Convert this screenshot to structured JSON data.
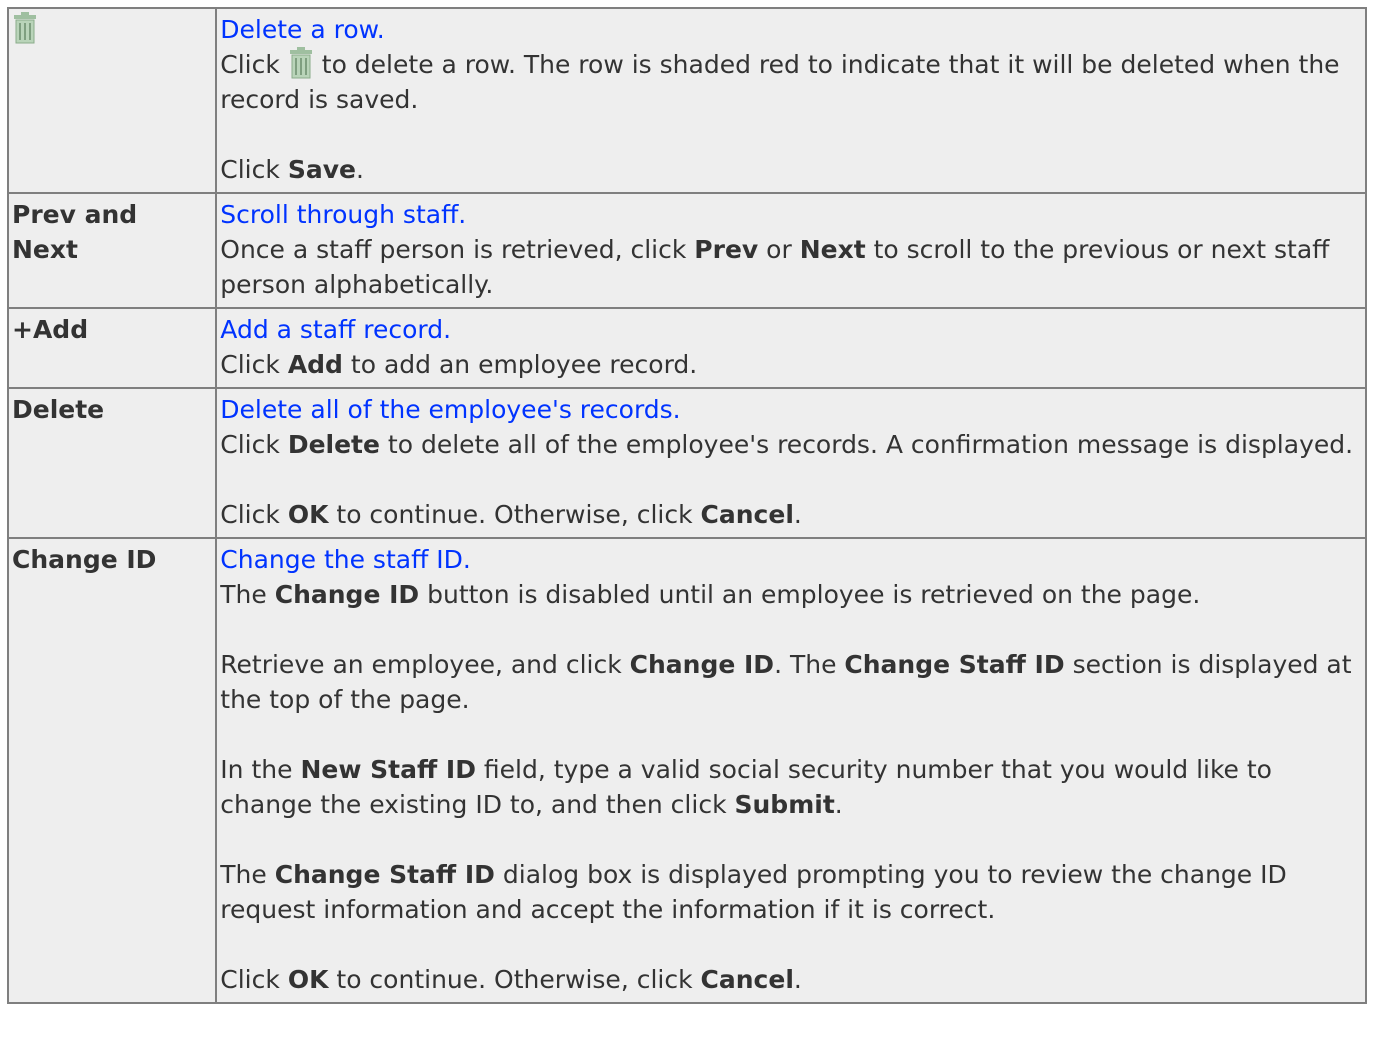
{
  "rows": [
    {
      "title": "Delete a row.",
      "icon": "trash-icon",
      "p1_a": "Click",
      "p1_b": "to delete a row. The row is shaded red to indicate that it will be deleted when the record is saved.",
      "p2_a": "Click",
      "p2_b": "Save",
      "p2_c": "."
    },
    {
      "key": "Prev and Next",
      "title": "Scroll through staff.",
      "p1_a": "Once a staff person is retrieved, click",
      "p1_b": "Prev",
      "p1_c": "or",
      "p1_d": "Next",
      "p1_e": "to scroll to the previous or next staff person alphabetically."
    },
    {
      "key": "+Add",
      "title": "Add a staff record.",
      "p1_a": "Click",
      "p1_b": "Add",
      "p1_c": "to add an employee record."
    },
    {
      "key": "Delete",
      "title": "Delete all of the employee's records.",
      "p1_a": "Click",
      "p1_b": "Delete",
      "p1_c": "to delete all of the employee's records. A confirmation message is displayed.",
      "p2_a": "Click",
      "p2_b": "OK",
      "p2_c": "to continue. Otherwise, click",
      "p2_d": "Cancel",
      "p2_e": "."
    },
    {
      "key": "Change ID",
      "title": "Change the staff ID.",
      "p1_a": "The",
      "p1_b": "Change ID",
      "p1_c": "button is disabled until an employee is retrieved on the page.",
      "p2_a": "Retrieve an employee, and click",
      "p2_b": "Change ID",
      "p2_c": ". The",
      "p2_d": "Change Staff ID",
      "p2_e": "section is displayed at the top of the page.",
      "p3_a": "In the",
      "p3_b": "New Staff ID",
      "p3_c": "field, type a valid social security number that you would like to change the existing ID to, and then click",
      "p3_d": "Submit",
      "p3_e": ".",
      "p4_a": "The",
      "p4_b": "Change Staff ID",
      "p4_c": "dialog box is displayed prompting you to review the change ID request information and accept the information if it is correct.",
      "p5_a": "Click",
      "p5_b": "OK",
      "p5_c": "to continue. Otherwise, click",
      "p5_d": "Cancel",
      "p5_e": "."
    }
  ],
  "colors": {
    "link": "#0033ff",
    "cell_bg": "#eeeeee",
    "border": "#7f7f7f",
    "icon": "#9fbfa0"
  }
}
